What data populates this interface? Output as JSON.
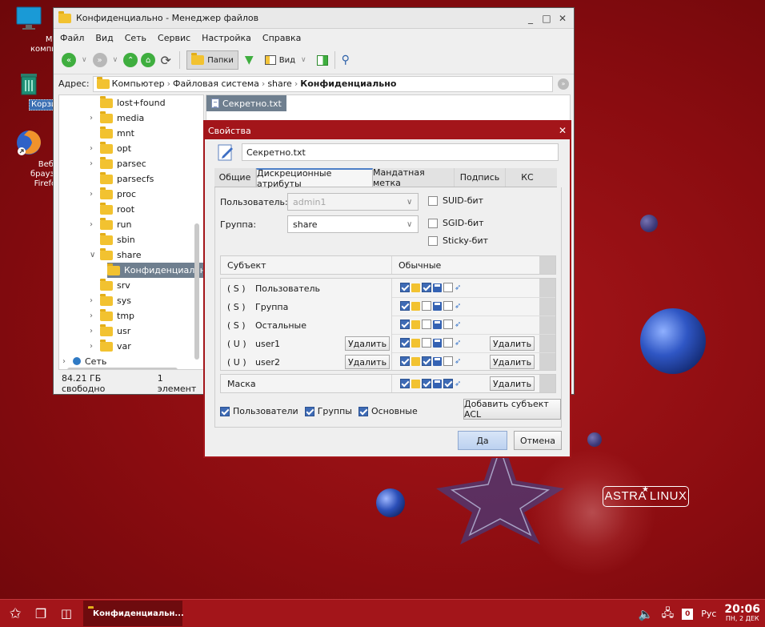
{
  "desktop": {
    "icons": [
      {
        "label": "Мой компьютер"
      },
      {
        "label": "Корзина"
      },
      {
        "label": "Веб-браузер Firefox"
      }
    ],
    "brand": "ASTRA LINUX"
  },
  "file_manager": {
    "title": "Конфиденциально - Менеджер файлов",
    "menu": [
      "Файл",
      "Вид",
      "Сеть",
      "Сервис",
      "Настройка",
      "Справка"
    ],
    "toolbar": {
      "folders_label": "Папки",
      "view_label": "Вид"
    },
    "address": {
      "label": "Адрес:",
      "crumbs": [
        "Компьютер",
        "Файловая система",
        "share",
        "Конфиденциально"
      ]
    },
    "tree": [
      {
        "label": "lost+found",
        "expandable": false
      },
      {
        "label": "media",
        "expandable": true
      },
      {
        "label": "mnt",
        "expandable": false
      },
      {
        "label": "opt",
        "expandable": true
      },
      {
        "label": "parsec",
        "expandable": true
      },
      {
        "label": "parsecfs",
        "expandable": false
      },
      {
        "label": "proc",
        "expandable": true
      },
      {
        "label": "root",
        "expandable": false
      },
      {
        "label": "run",
        "expandable": true
      },
      {
        "label": "sbin",
        "expandable": false
      },
      {
        "label": "share",
        "expandable": true
      },
      {
        "label": "Конфиденциальн",
        "expandable": false
      },
      {
        "label": "srv",
        "expandable": false
      },
      {
        "label": "sys",
        "expandable": true
      },
      {
        "label": "tmp",
        "expandable": true
      },
      {
        "label": "usr",
        "expandable": true
      },
      {
        "label": "var",
        "expandable": true
      },
      {
        "label": "Сеть",
        "expandable": true
      }
    ],
    "status": {
      "free": "84.21 ГБ свободно",
      "count": "1 элемент"
    },
    "files": [
      {
        "name": "Секретно.txt"
      }
    ]
  },
  "dialog": {
    "title": "Свойства",
    "filename": "Секретно.txt",
    "tabs": [
      "Общие",
      "Дискреционные атрибуты",
      "Мандатная метка",
      "Подпись",
      "КС"
    ],
    "active_tab": "Дискреционные атрибуты",
    "user_label": "Пользователь:",
    "user_value": "admin1",
    "group_label": "Группа:",
    "group_value": "share",
    "suid": "SUID-бит",
    "sgid": "SGID-бит",
    "sticky": "Sticky-бит",
    "col_subject": "Субъект",
    "col_normal": "Обычные",
    "delete_label": "Удалить",
    "rows": [
      {
        "tag": "( S )",
        "name": "Пользователь",
        "r": true,
        "w": true,
        "x": false
      },
      {
        "tag": "( S )",
        "name": "Группа",
        "r": true,
        "w": false,
        "x": false
      },
      {
        "tag": "( S )",
        "name": "Остальные",
        "r": true,
        "w": false,
        "x": false
      },
      {
        "tag": "( U )",
        "name": "user1",
        "r": true,
        "w": false,
        "x": false
      },
      {
        "tag": "( U )",
        "name": "user2",
        "r": true,
        "w": true,
        "x": false
      }
    ],
    "mask_label": "Маска",
    "mask": {
      "r": true,
      "w": true,
      "x": true
    },
    "show_users": "Пользователи",
    "show_groups": "Группы",
    "show_main": "Основные",
    "add_acl": "Добавить субъект ACL",
    "ok": "Да",
    "cancel": "Отмена"
  },
  "taskbar": {
    "task_label": "Конфиденциальн...",
    "lang": "Рус",
    "kbd_indicator": "0",
    "time": "20:06",
    "date": "ПН, 2 ДЕК"
  }
}
